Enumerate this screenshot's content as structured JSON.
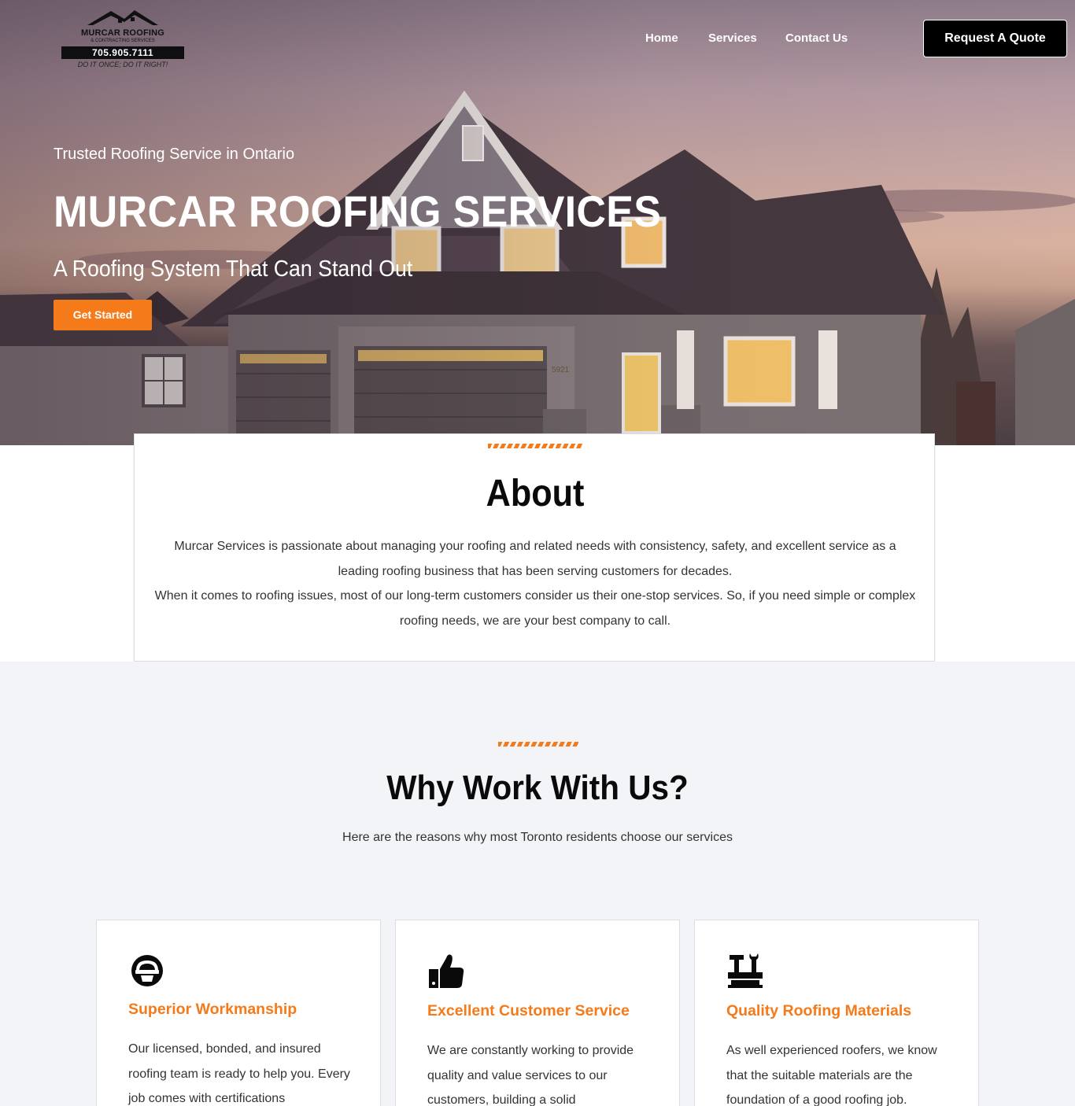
{
  "header": {
    "logo": {
      "brand": "MURCAR ROOFING",
      "brand_sub": "& CONTRACTING SERVICES",
      "phone": "705.905.7111",
      "motto": "DO IT ONCE; DO IT RIGHT!"
    },
    "nav": [
      "Home",
      "Services",
      "Contact Us"
    ],
    "cta_label": "Request A Quote"
  },
  "hero": {
    "tagline": "Trusted Roofing Service in Ontario",
    "title": "MURCAR ROOFING SERVICES",
    "subtitle": "A Roofing System That Can Stand Out",
    "button_label": "Get Started",
    "house_number": "5921"
  },
  "about": {
    "title": "About",
    "paragraph1": "Murcar Services is passionate about managing your roofing and related needs with consistency, safety, and excellent service as a leading roofing business that has been serving customers for decades.",
    "paragraph2": "When it comes to roofing issues, most of our long-term customers consider us their one-stop services. So, if you need simple or complex roofing needs, we are your best company to call."
  },
  "why": {
    "title": "Why Work With Us?",
    "subtitle": "Here are the reasons why most Toronto residents choose our services",
    "cards": [
      {
        "icon": "hard-hat-icon",
        "title": "Superior Workmanship",
        "text": "Our licensed, bonded, and insured roofing team is ready to help you. Every job comes with certifications"
      },
      {
        "icon": "thumbs-up-icon",
        "title": "Excellent Customer Service",
        "text": "We are constantly working to provide quality and value services to our customers, building a solid"
      },
      {
        "icon": "tools-icon",
        "title": "Quality Roofing Materials",
        "text": "As well experienced roofers, we know that the suitable materials are the foundation of a good roofing job."
      }
    ]
  },
  "colors": {
    "accent": "#f47a1a",
    "dark": "#000000",
    "section_bg": "#f3f4f8"
  }
}
